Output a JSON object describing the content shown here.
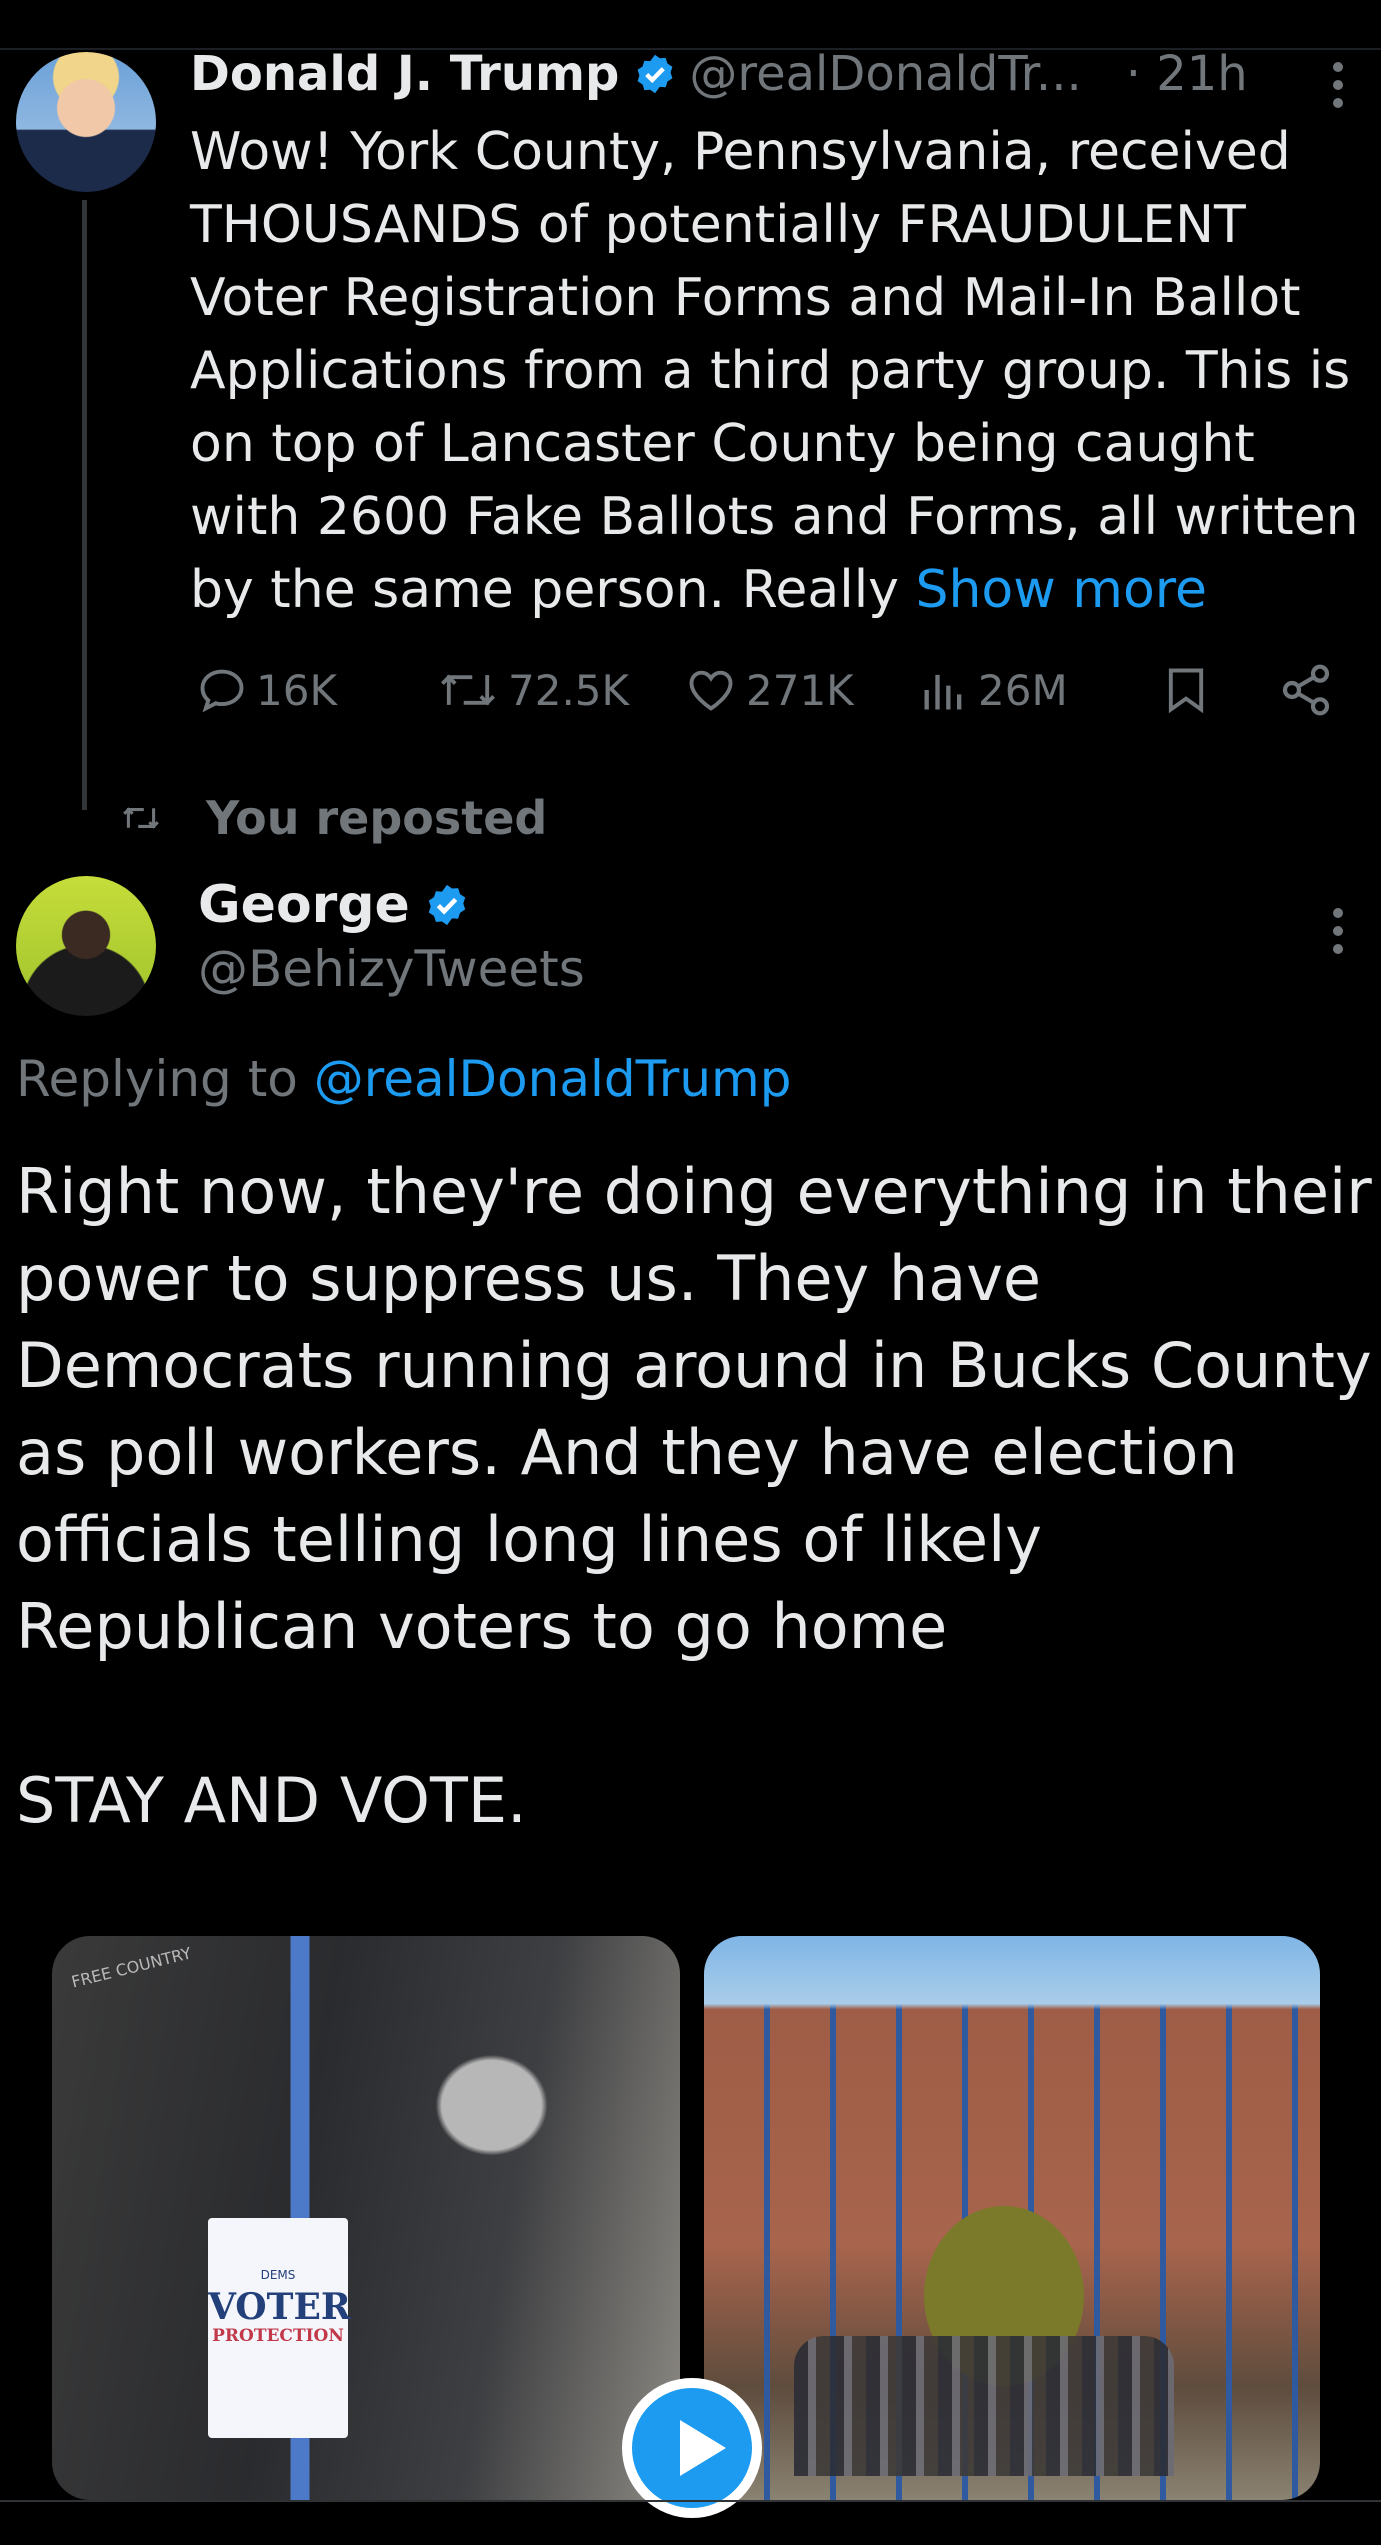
{
  "tweet1": {
    "name": "Donald J. Trump",
    "handle": "@realDonaldTr...",
    "time": "· 21h",
    "text": "Wow! York County, Pennsylvania, received THOUSANDS of potentially FRAUDULENT Voter Registration Forms and Mail-In Ballot Applications from a third party group. This is on top of Lancaster County being caught with 2600 Fake Ballots and Forms, all written by the same person. Really ",
    "show_more": "Show more",
    "replies": "16K",
    "reposts": "72.5K",
    "likes": "271K",
    "views": "26M"
  },
  "repost_label": "You reposted",
  "tweet2": {
    "name": "George",
    "handle": "@BehizyTweets",
    "replying_prefix": "Replying to ",
    "replying_handle": "@realDonaldTrump",
    "text": "Right now, they're doing everything in their power to suppress us. They have Democrats running around in Bucks County as poll workers. And they have election officials telling long lines of likely Republican voters to go home\n\nSTAY AND VOTE.",
    "media": {
      "badge_small": "DEMS",
      "badge_big": "VOTER",
      "badge_mid": "PROTECTION",
      "watermark": "FREE COUNTRY"
    }
  },
  "colors": {
    "accent": "#1d9bf0",
    "muted": "#71767b",
    "text": "#e7e9ea",
    "background": "#000000"
  },
  "icons": [
    "reply-icon",
    "repost-icon",
    "like-icon",
    "views-icon",
    "bookmark-icon",
    "share-icon",
    "verified-icon",
    "more-icon",
    "play-icon"
  ]
}
